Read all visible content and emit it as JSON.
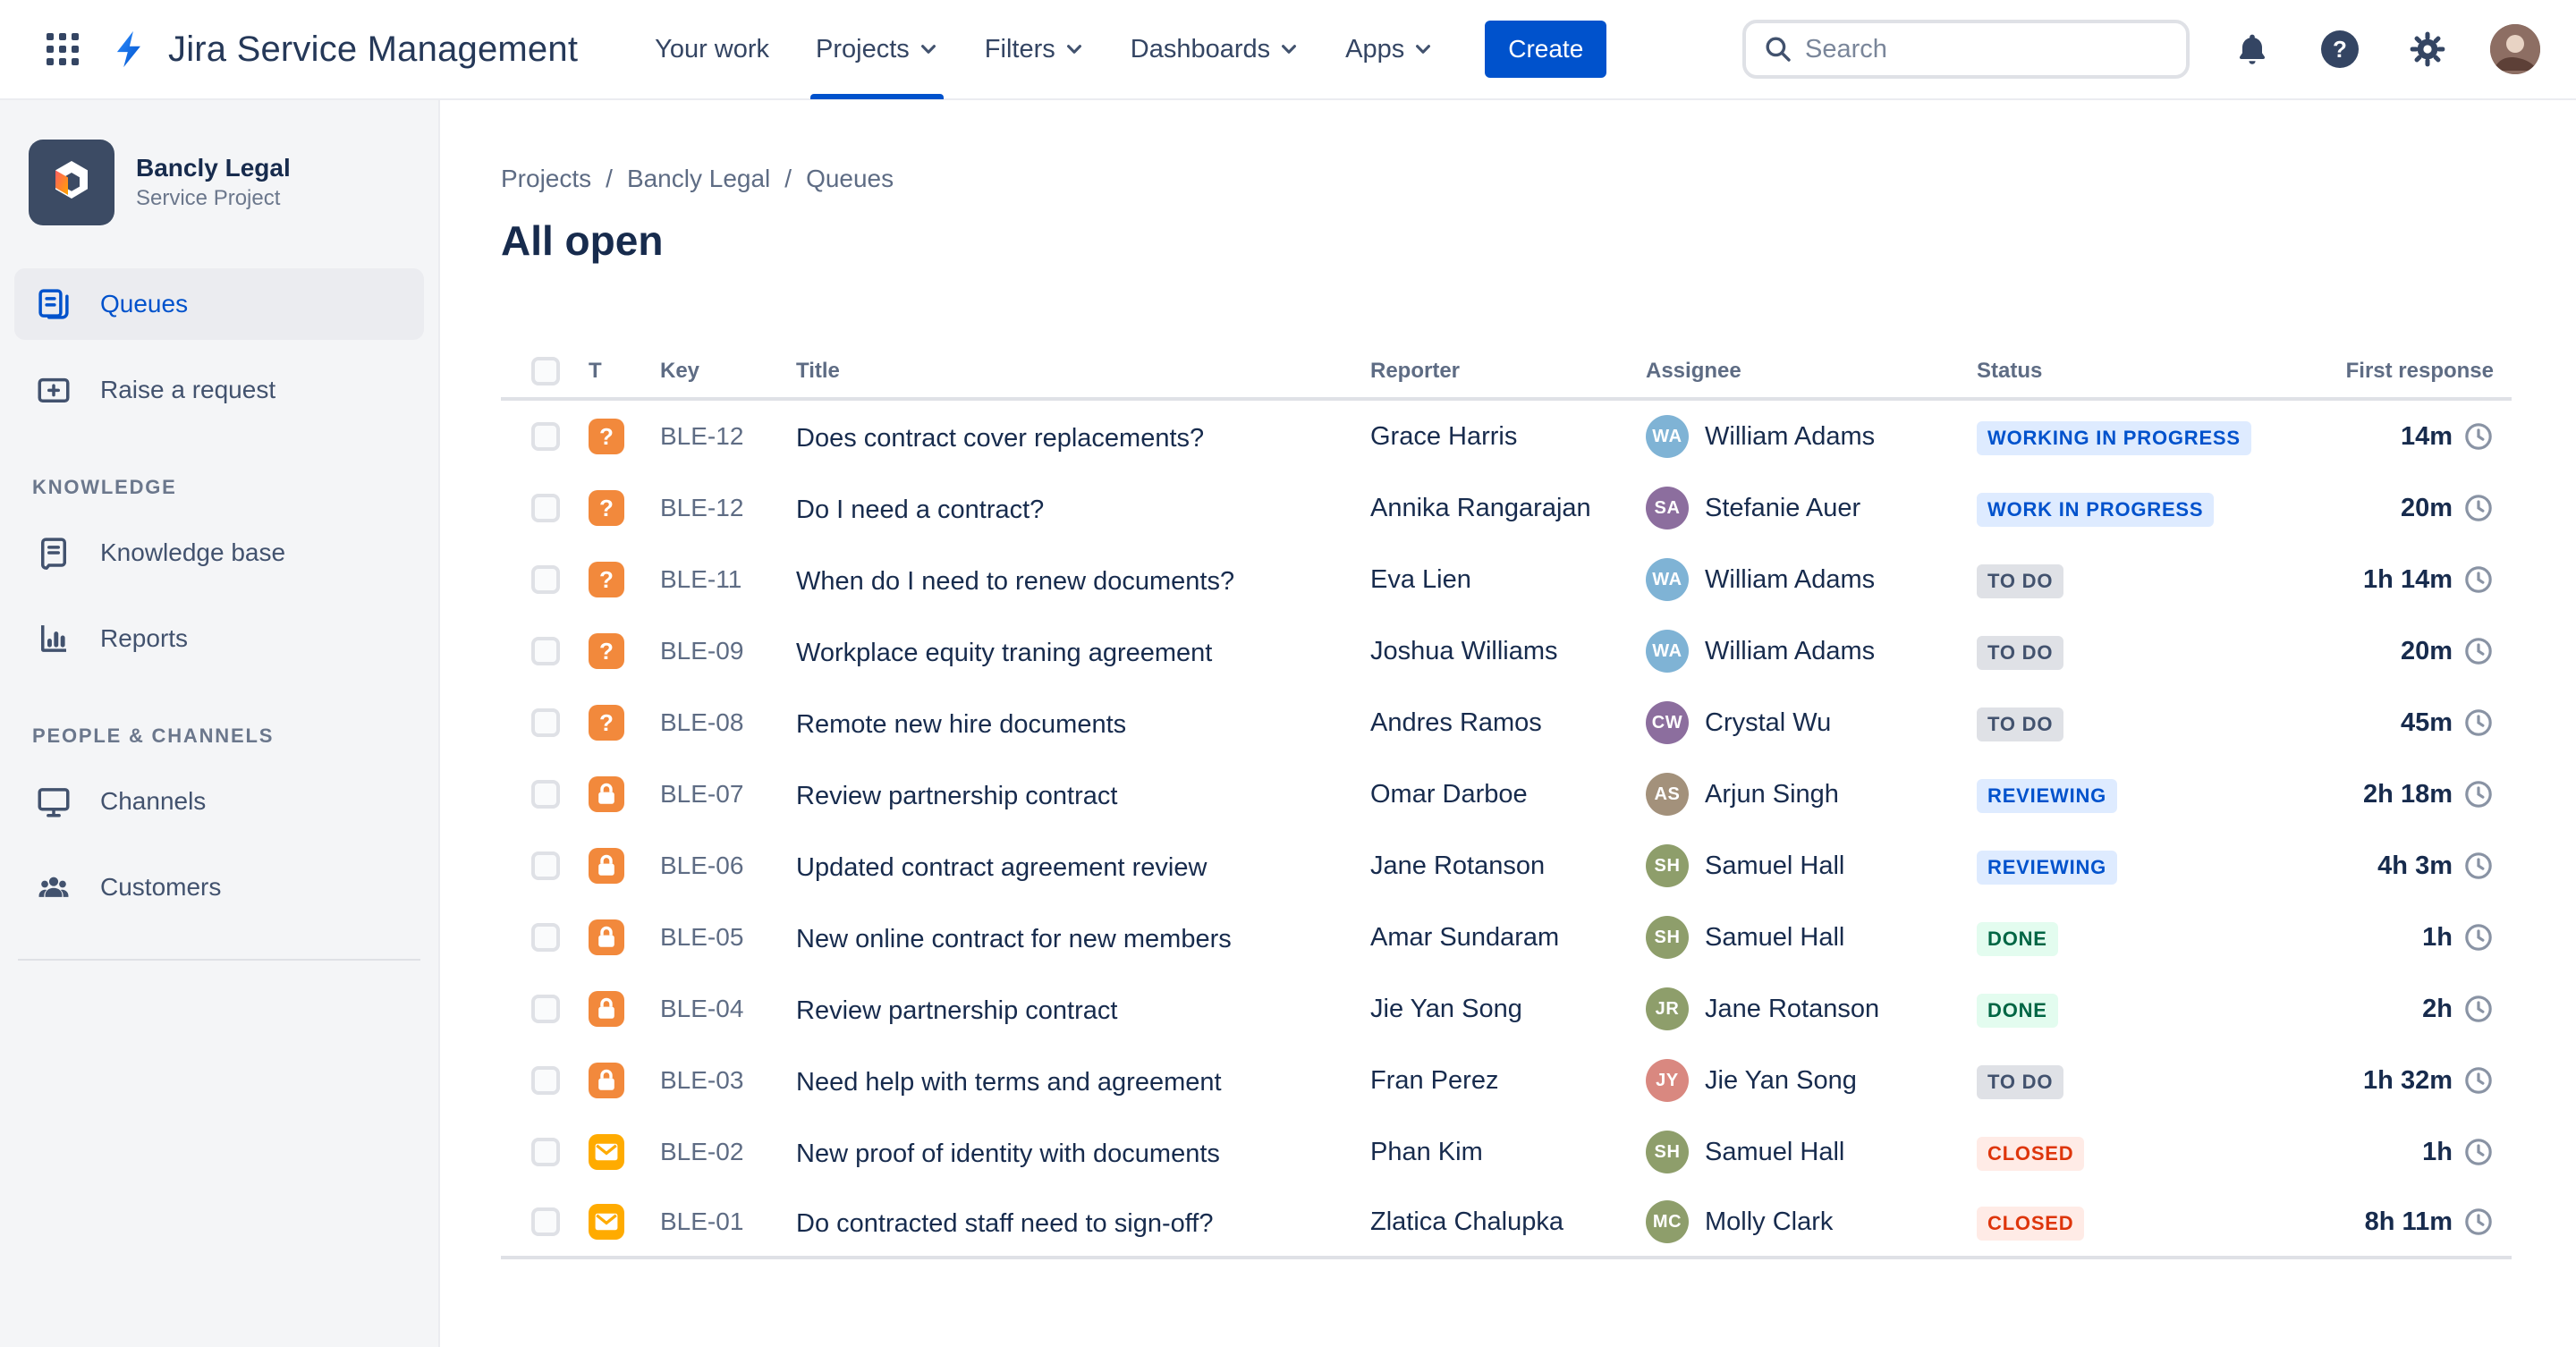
{
  "topbar": {
    "brand": "Jira Service Management",
    "nav": [
      {
        "label": "Your work",
        "chevron": false,
        "active": false
      },
      {
        "label": "Projects",
        "chevron": true,
        "active": true
      },
      {
        "label": "Filters",
        "chevron": true,
        "active": false
      },
      {
        "label": "Dashboards",
        "chevron": true,
        "active": false
      },
      {
        "label": "Apps",
        "chevron": true,
        "active": false
      }
    ],
    "create_label": "Create",
    "search_placeholder": "Search",
    "icons": [
      "app-switcher-icon",
      "notifications-icon",
      "help-icon",
      "settings-icon",
      "user-avatar"
    ]
  },
  "sidebar": {
    "project_name": "Bancly Legal",
    "project_type": "Service Project",
    "items": [
      {
        "label": "Queues",
        "icon": "queues-icon",
        "active": true
      },
      {
        "label": "Raise a request",
        "icon": "raise-request-icon",
        "active": false
      }
    ],
    "sections": [
      {
        "title": "KNOWLEDGE",
        "items": [
          {
            "label": "Knowledge base",
            "icon": "knowledge-base-icon"
          },
          {
            "label": "Reports",
            "icon": "reports-icon"
          }
        ]
      },
      {
        "title": "PEOPLE & CHANNELS",
        "items": [
          {
            "label": "Channels",
            "icon": "channels-icon"
          },
          {
            "label": "Customers",
            "icon": "customers-icon"
          }
        ]
      }
    ]
  },
  "breadcrumb": {
    "items": [
      "Projects",
      "Bancly Legal",
      "Queues"
    ]
  },
  "main": {
    "title": "All open"
  },
  "table": {
    "columns": {
      "type": "T",
      "key": "Key",
      "title": "Title",
      "reporter": "Reporter",
      "assignee": "Assignee",
      "status": "Status",
      "response": "First response"
    },
    "rows": [
      {
        "type": "question",
        "key": "BLE-12",
        "title": "Does contract cover replacements?",
        "reporter": "Grace Harris",
        "assignee": "William Adams",
        "status": "WORKING IN PROGRESS",
        "status_type": "inprogress",
        "response": "14m"
      },
      {
        "type": "question",
        "key": "BLE-12",
        "title": "Do I need a contract?",
        "reporter": "Annika Rangarajan",
        "assignee": "Stefanie Auer",
        "status": "WORK IN PROGRESS",
        "status_type": "inprogress",
        "response": "20m"
      },
      {
        "type": "question",
        "key": "BLE-11",
        "title": "When do I need to renew documents?",
        "reporter": "Eva Lien",
        "assignee": "William Adams",
        "status": "TO DO",
        "status_type": "todo",
        "response": "1h 14m"
      },
      {
        "type": "question",
        "key": "BLE-09",
        "title": "Workplace equity traning agreement",
        "reporter": "Joshua Williams",
        "assignee": "William Adams",
        "status": "TO DO",
        "status_type": "todo",
        "response": "20m"
      },
      {
        "type": "question",
        "key": "BLE-08",
        "title": "Remote new hire documents",
        "reporter": "Andres Ramos",
        "assignee": "Crystal Wu",
        "status": "TO DO",
        "status_type": "todo",
        "response": "45m"
      },
      {
        "type": "lock",
        "key": "BLE-07",
        "title": "Review partnership contract",
        "reporter": "Omar Darboe",
        "assignee": "Arjun Singh",
        "status": "REVIEWING",
        "status_type": "inprogress",
        "response": "2h 18m"
      },
      {
        "type": "lock",
        "key": "BLE-06",
        "title": "Updated contract agreement review",
        "reporter": "Jane Rotanson",
        "assignee": "Samuel Hall",
        "status": "REVIEWING",
        "status_type": "inprogress",
        "response": "4h 3m"
      },
      {
        "type": "lock",
        "key": "BLE-05",
        "title": "New online contract for new members",
        "reporter": "Amar Sundaram",
        "assignee": "Samuel Hall",
        "status": "DONE",
        "status_type": "done",
        "response": "1h"
      },
      {
        "type": "lock",
        "key": "BLE-04",
        "title": "Review partnership contract",
        "reporter": "Jie Yan Song",
        "assignee": "Jane Rotanson",
        "status": "DONE",
        "status_type": "done",
        "response": "2h"
      },
      {
        "type": "lock",
        "key": "BLE-03",
        "title": "Need help with terms and agreement",
        "reporter": "Fran Perez",
        "assignee": "Jie Yan Song",
        "status": "TO DO",
        "status_type": "todo",
        "response": "1h 32m"
      },
      {
        "type": "email",
        "key": "BLE-02",
        "title": "New proof of identity with documents",
        "reporter": "Phan Kim",
        "assignee": "Samuel Hall",
        "status": "CLOSED",
        "status_type": "closed",
        "response": "1h"
      },
      {
        "type": "email",
        "key": "BLE-01",
        "title": "Do contracted staff need to sign-off?",
        "reporter": "Zlatica Chalupka",
        "assignee": "Molly Clark",
        "status": "CLOSED",
        "status_type": "closed",
        "response": "8h 11m"
      }
    ]
  },
  "colors": {
    "accent": "#0052CC",
    "brand_text": "#253858",
    "question_icon_bg": "#F2893C",
    "lock_icon_bg": "#F2893C",
    "email_icon_bg": "#FFAB00",
    "status_inprogress_bg": "#DEEBFF",
    "status_inprogress_text": "#0052CC",
    "status_todo_bg": "#DFE1E6",
    "status_todo_text": "#42526E",
    "status_done_bg": "#E3FCEF",
    "status_done_text": "#006644",
    "status_closed_bg": "#FFEBE6",
    "status_closed_text": "#DE350B"
  }
}
